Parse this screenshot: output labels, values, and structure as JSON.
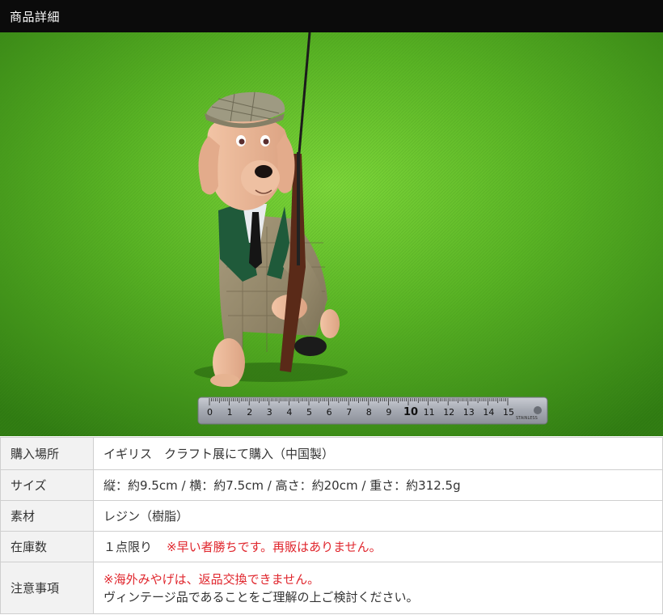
{
  "header": {
    "title": "商品詳細"
  },
  "details": {
    "purchase_place": {
      "label": "購入場所",
      "value": "イギリス　クラフト展にて購入（中国製）"
    },
    "size": {
      "label": "サイズ",
      "value": "縦：約9.5cm / 横：約7.5cm / 高さ：約20cm / 重さ：約312.5g"
    },
    "material": {
      "label": "素材",
      "value": "レジン（樹脂）"
    },
    "stock": {
      "label": "在庫数",
      "value": "１点限り",
      "note": "※早い者勝ちです。再販はありません。"
    },
    "notes": {
      "label": "注意事項",
      "line1": "※海外みやげは、返品交換できません。",
      "line2": "ヴィンテージ品であることをご理解の上ご検討ください。"
    }
  },
  "photo": {
    "ruler_numbers": [
      "0",
      "1",
      "2",
      "3",
      "4",
      "5",
      "6",
      "7",
      "8",
      "9",
      "10",
      "11",
      "12",
      "13",
      "14",
      "15"
    ]
  },
  "colors": {
    "header_bg": "#0b0b0b",
    "label_bg": "#f2f2f2",
    "warning_red": "#e0262d",
    "grass": "#4a9a1c"
  }
}
